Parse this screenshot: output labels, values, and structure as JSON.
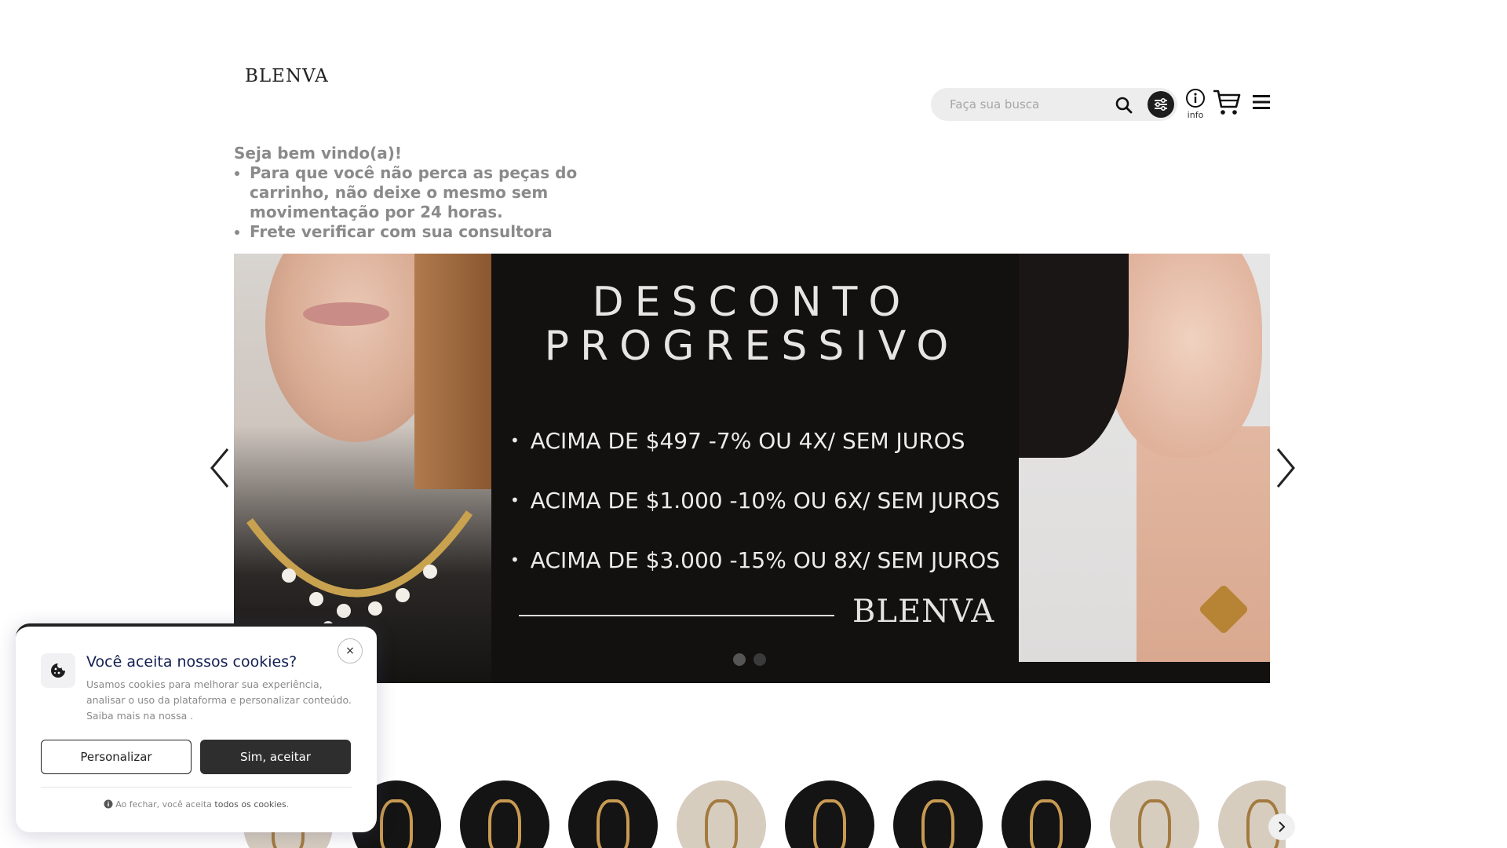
{
  "header": {
    "logo": "BLENVA",
    "search_placeholder": "Faça sua busca",
    "info_label": "info"
  },
  "welcome": {
    "title": "Seja bem vindo(a)!",
    "bullets": [
      "Para que você não perca as peças do carrinho, não deixe o mesmo sem movimentação por 24 horas.",
      "Frete verificar com sua consultora"
    ]
  },
  "banner": {
    "title_line1": "DESCONTO",
    "title_line2": "PROGRESSIVO",
    "tiers": [
      "ACIMA DE  $497    -7% OU 4X/  SEM JUROS",
      "ACIMA DE $1.000   -10% OU 6X/ SEM JUROS",
      "ACIMA DE $3.000   -15% OU 8X/ SEM JUROS"
    ],
    "brand": "BLENVA",
    "slide_count": 2,
    "active_slide": 1
  },
  "cookie_banner": {
    "title": "Você aceita nossos cookies?",
    "text": "Usamos cookies para melhorar sua experiência, analisar o uso da plataforma e personalizar conteúdo. Saiba mais na nossa .",
    "customize_label": "Personalizar",
    "accept_label": "Sim, aceitar",
    "close_label": "×",
    "footer_prefix": "Ao fechar, você aceita",
    "footer_link": "todos os cookies",
    "footer_suffix": "."
  },
  "colors": {
    "accent_dark": "#2e2e2e",
    "banner_bg": "#121110",
    "cookie_title": "#141f52"
  },
  "icons": [
    "search-icon",
    "filter-icon",
    "info-icon",
    "cart-icon",
    "menu-icon",
    "chevron-left-icon",
    "chevron-right-icon",
    "cookie-icon",
    "close-icon"
  ]
}
